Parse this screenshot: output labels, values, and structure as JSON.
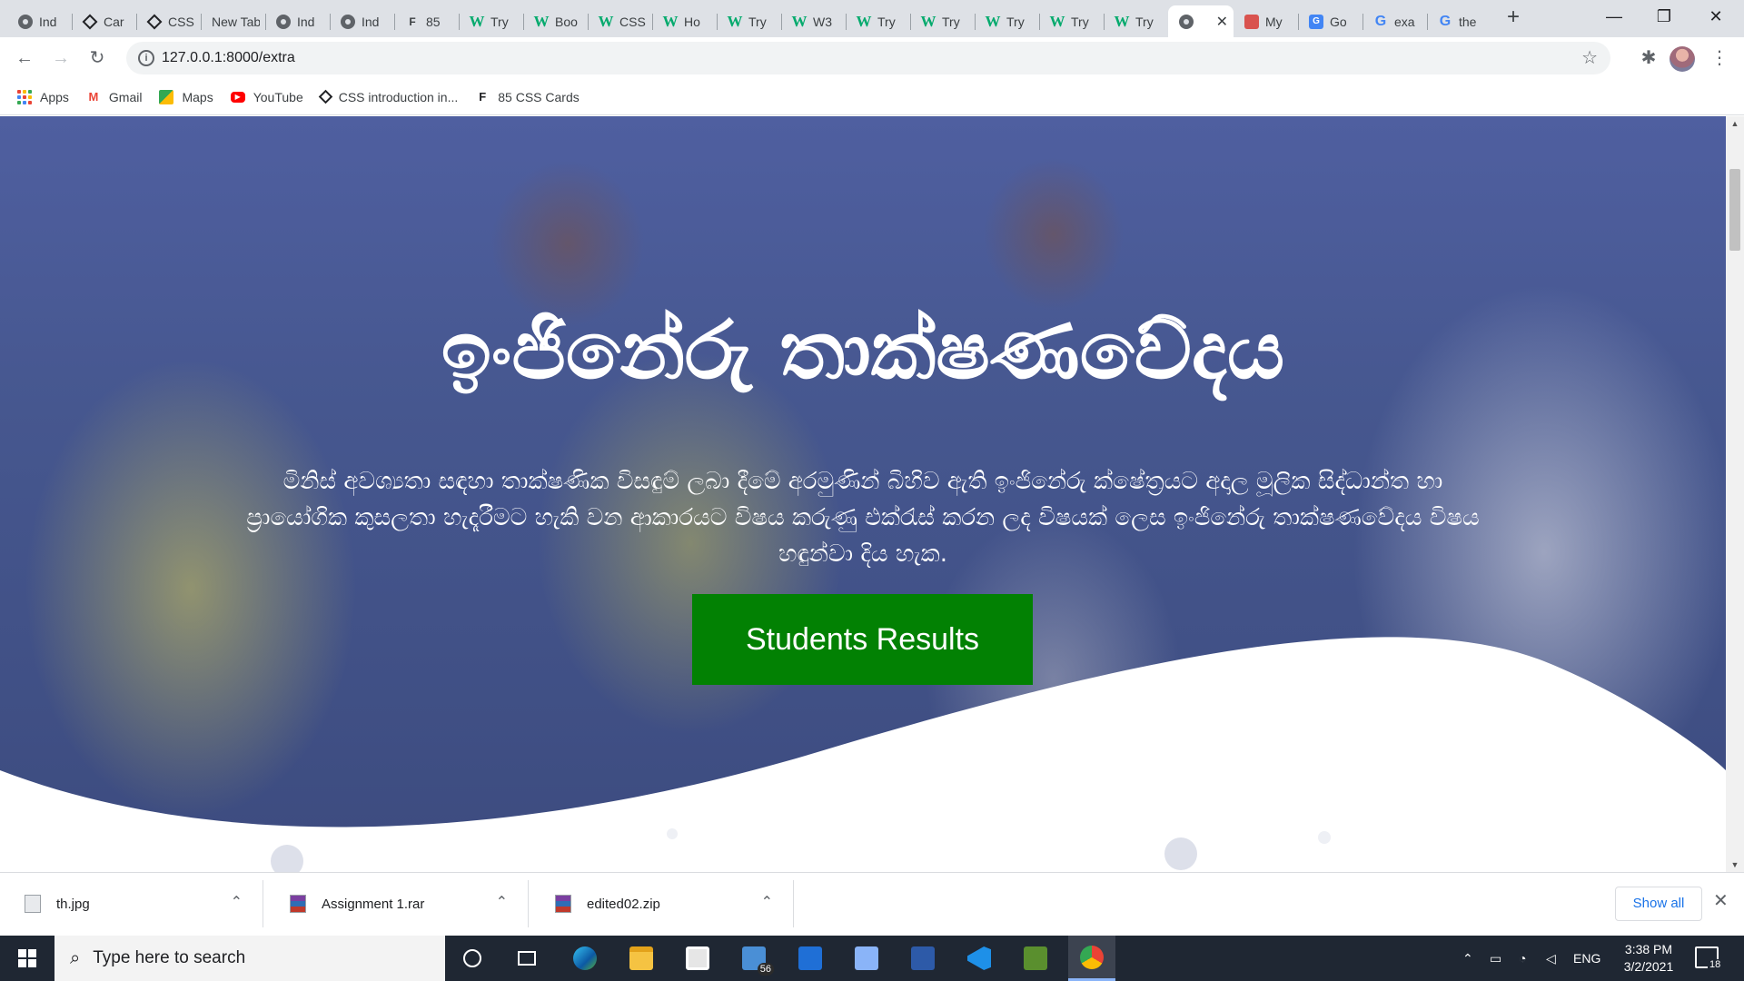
{
  "browser": {
    "tabs": [
      {
        "title": "Ind",
        "icon": "globe"
      },
      {
        "title": "Car",
        "icon": "codepen"
      },
      {
        "title": "CSS",
        "icon": "codepen"
      },
      {
        "title": "New Tab",
        "icon": "none"
      },
      {
        "title": "Ind",
        "icon": "globe"
      },
      {
        "title": "Ind",
        "icon": "globe"
      },
      {
        "title": "85",
        "icon": "f"
      },
      {
        "title": "Try",
        "icon": "w3"
      },
      {
        "title": "Boo",
        "icon": "w3"
      },
      {
        "title": "CSS",
        "icon": "w3"
      },
      {
        "title": "Ho",
        "icon": "w3"
      },
      {
        "title": "Try",
        "icon": "w3"
      },
      {
        "title": "W3",
        "icon": "w3"
      },
      {
        "title": "Try",
        "icon": "w3"
      },
      {
        "title": "Try",
        "icon": "w3"
      },
      {
        "title": "Try",
        "icon": "w3"
      },
      {
        "title": "Try",
        "icon": "w3"
      },
      {
        "title": "Try",
        "icon": "w3"
      },
      {
        "title": "",
        "icon": "globe",
        "active": true
      },
      {
        "title": "My",
        "icon": "my"
      },
      {
        "title": "Go",
        "icon": "gt"
      },
      {
        "title": "exa",
        "icon": "g"
      },
      {
        "title": "the",
        "icon": "g"
      }
    ],
    "new_tab_symbol": "+",
    "window_controls": {
      "minimize": "—",
      "maximize": "❐",
      "close": "✕"
    },
    "toolbar": {
      "back": "←",
      "forward": "→",
      "reload": "↻",
      "url": "127.0.0.1:8000/extra",
      "info_symbol": "i",
      "star": "☆",
      "extensions": "✱",
      "menu": "⋮"
    },
    "bookmarks": [
      {
        "label": "Apps",
        "icon": "apps"
      },
      {
        "label": "Gmail",
        "icon": "gmail"
      },
      {
        "label": "Maps",
        "icon": "maps"
      },
      {
        "label": "YouTube",
        "icon": "youtube"
      },
      {
        "label": "CSS introduction in...",
        "icon": "codepen"
      },
      {
        "label": "85 CSS Cards",
        "icon": "f"
      }
    ]
  },
  "page": {
    "hero_title": "ඉංජිනේරු තාක්ෂණවේදය",
    "hero_description": "මිනිස් අවශ්‍යතා සඳහා තාක්ෂණික විසඳුම් ලබා දීමේ අරමුණින් බිහිව ඇති ඉංජිනේරු ක්ෂේත්‍රයට අදාල මූලික සිද්ධාන්ත හා ප්‍රායෝගික කුසලතා හැදෑරීමට හැකි වන ආකාරයට විෂය කරුණු එක්රැස් කරන ලද විෂයක් ලෙස ඉංජිනේරු තාක්ෂණවේදය විෂය හඳුන්වා දිය හැක.",
    "cta_label": "Students Results",
    "colors": {
      "cta": "#028103",
      "overlay": "#4f5fa0"
    }
  },
  "downloads": {
    "items": [
      {
        "name": "th.jpg",
        "icon": "image-file"
      },
      {
        "name": "Assignment 1.rar",
        "icon": "archive-file"
      },
      {
        "name": "edited02.zip",
        "icon": "archive-file"
      }
    ],
    "show_all": "Show all",
    "close": "✕"
  },
  "taskbar": {
    "search_placeholder": "Type here to search",
    "mail_badge": "56",
    "language": "ENG",
    "time": "3:38 PM",
    "date": "3/2/2021",
    "notifications": "18"
  }
}
